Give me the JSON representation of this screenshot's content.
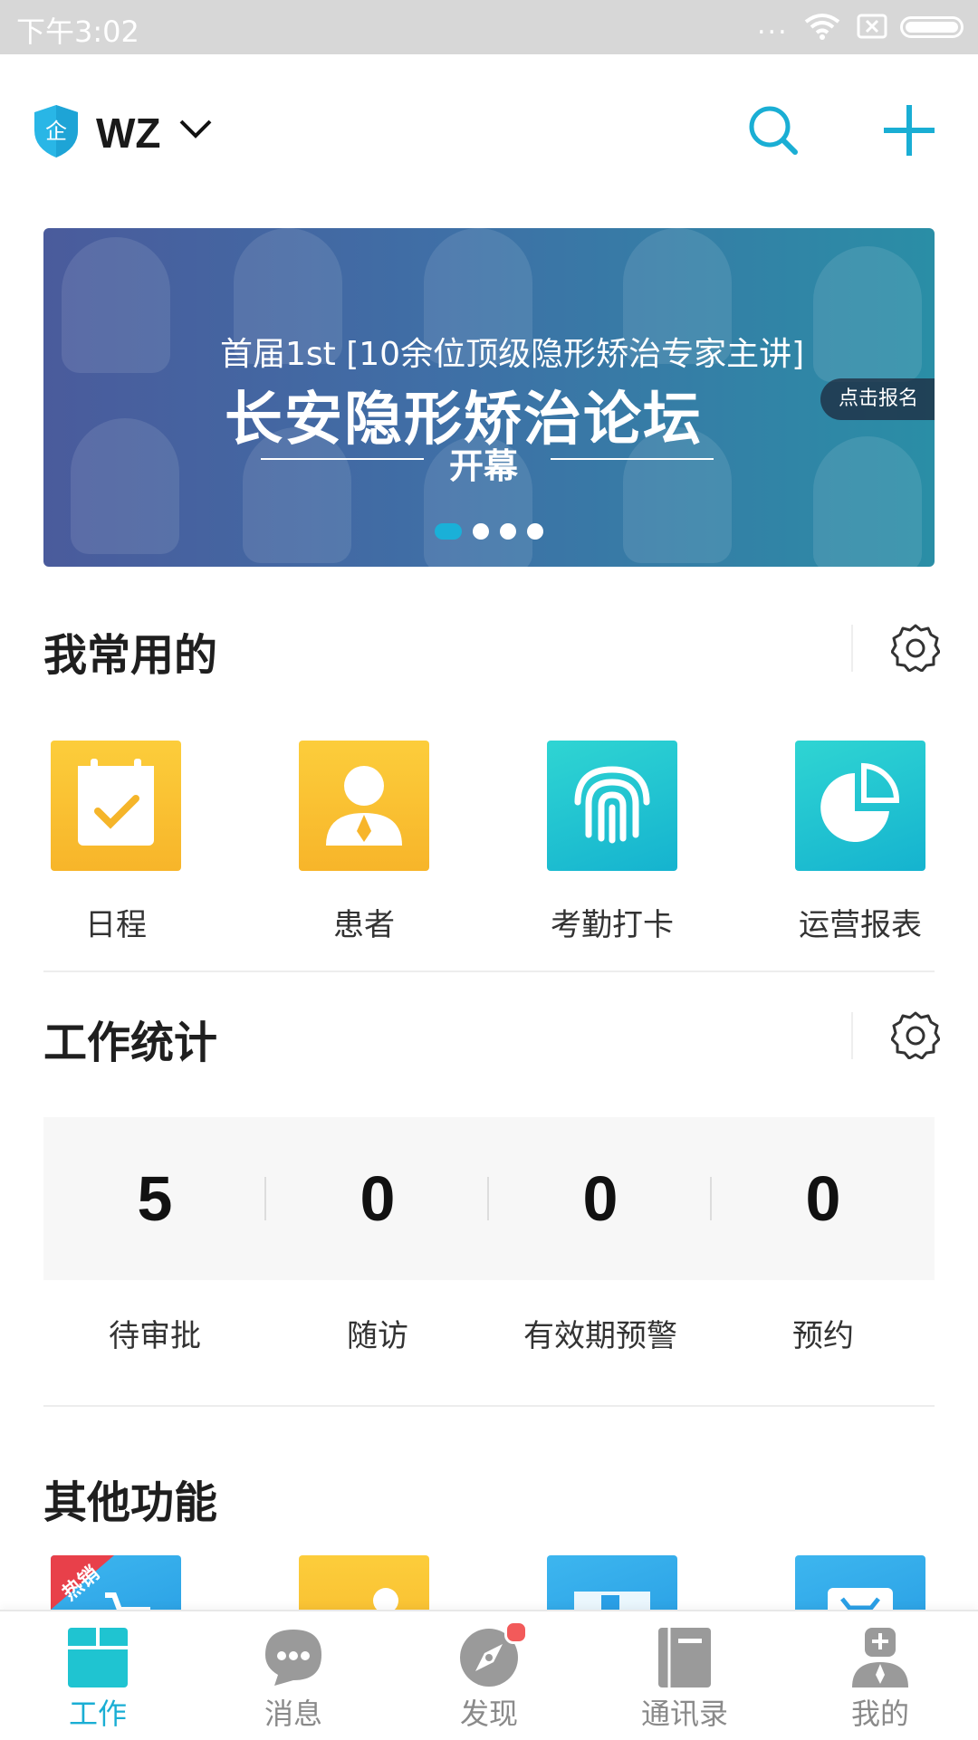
{
  "status_bar": {
    "time": "下午3:02",
    "dots": "..."
  },
  "header": {
    "org_name": "WZ",
    "org_badge_char": "企"
  },
  "banner": {
    "subtitle": "首届1st [10余位顶级隐形矫治专家主讲]",
    "title": "长安隐形矫治论坛",
    "opening": "开幕",
    "tag": "点击报名",
    "page_count": 4,
    "active_page": 1
  },
  "favorites": {
    "title": "我常用的",
    "items": [
      {
        "label": "日程",
        "icon": "calendar-check-icon"
      },
      {
        "label": "患者",
        "icon": "person-icon"
      },
      {
        "label": "考勤打卡",
        "icon": "fingerprint-icon"
      },
      {
        "label": "运营报表",
        "icon": "pie-chart-icon"
      }
    ]
  },
  "work_stats": {
    "title": "工作统计",
    "items": [
      {
        "value": "5",
        "label": "待审批"
      },
      {
        "value": "0",
        "label": "随访"
      },
      {
        "value": "0",
        "label": "有效期预警"
      },
      {
        "value": "0",
        "label": "预约"
      }
    ]
  },
  "other_functions": {
    "title": "其他功能",
    "hot_tag": "热销"
  },
  "bottom_nav": {
    "items": [
      {
        "label": "工作",
        "icon": "work-icon",
        "active": true
      },
      {
        "label": "消息",
        "icon": "message-icon",
        "active": false
      },
      {
        "label": "发现",
        "icon": "compass-icon",
        "active": false
      },
      {
        "label": "通讯录",
        "icon": "contacts-icon",
        "active": false
      },
      {
        "label": "我的",
        "icon": "profile-icon",
        "active": false
      }
    ]
  },
  "colors": {
    "accent": "#1aaed4",
    "yellow": "#f9c033",
    "teal": "#1fc4d1",
    "badge": "#f25a5a"
  }
}
